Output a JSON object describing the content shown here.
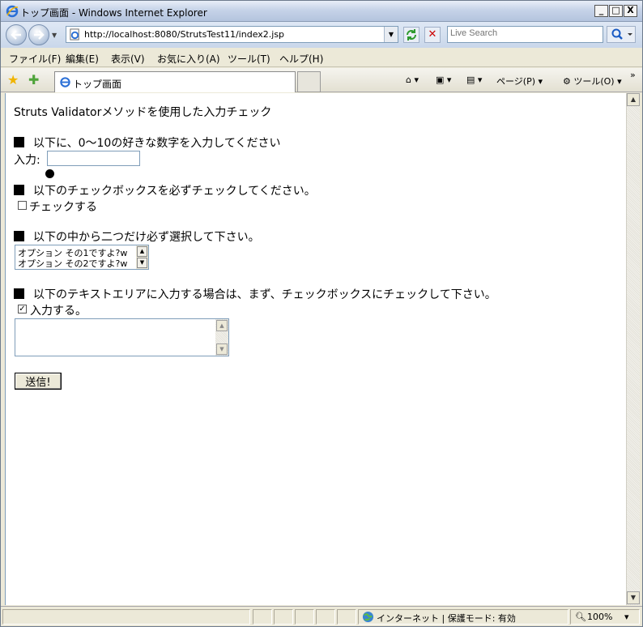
{
  "window": {
    "title": "トップ画面 - Windows Internet Explorer",
    "minimize": "_",
    "maximize": "□",
    "close": "X"
  },
  "address": {
    "url": "http://localhost:8080/StrutsTest11/index2.jsp",
    "search_placeholder": "Live Search"
  },
  "menu": {
    "items": [
      "ファイル(F)",
      "編集(E)",
      "表示(V)",
      "お気に入り(A)",
      "ツール(T)",
      "ヘルプ(H)"
    ]
  },
  "tabs": {
    "active_label": "トップ画面",
    "page_label": "ページ(P)",
    "tools_label": "ツール(O)",
    "more": "»"
  },
  "page": {
    "heading": "Struts Validatorメソッドを使用した入力チェック",
    "q1_label": "以下に、0〜10の好きな数字を入力してください",
    "input_label": "入力:",
    "q2_label": "以下のチェックボックスを必ずチェックしてください。",
    "checkbox_label": "チェックする",
    "q3_label": "以下の中から二つだけ必ず選択して下さい。",
    "options": [
      "オプション その1ですよ?w",
      "オプション その2ですよ?w"
    ],
    "q4_label": "以下のテキストエリアに入力する場合は、まず、チェックボックスにチェックして下さい。",
    "checkbox2_label": "入力する。",
    "checkbox2_checked": true,
    "submit_label": "送信!"
  },
  "status": {
    "zone": "インターネット | 保護モード: 有効",
    "zoom": "100%"
  }
}
